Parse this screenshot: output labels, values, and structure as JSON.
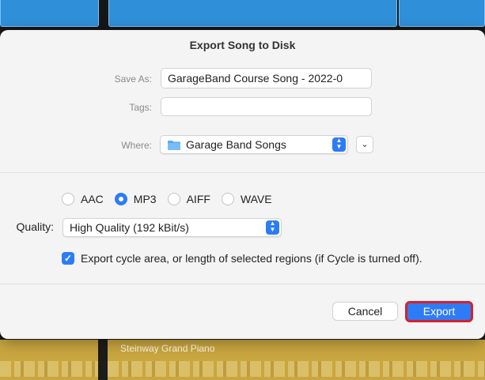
{
  "background": {
    "region_label": "Steinway Grand Piano"
  },
  "dialog": {
    "title": "Export Song to Disk",
    "save_as_label": "Save As:",
    "save_as_value": "GarageBand Course Song - 2022-0",
    "tags_label": "Tags:",
    "tags_value": "",
    "where_label": "Where:",
    "where_value": "Garage Band Songs",
    "formats": [
      {
        "label": "AAC",
        "selected": false
      },
      {
        "label": "MP3",
        "selected": true
      },
      {
        "label": "AIFF",
        "selected": false
      },
      {
        "label": "WAVE",
        "selected": false
      }
    ],
    "quality_label": "Quality:",
    "quality_value": "High Quality (192 kBit/s)",
    "export_cycle_label": "Export cycle area, or length of selected regions (if Cycle is turned off).",
    "export_cycle_checked": true,
    "cancel_label": "Cancel",
    "export_label": "Export"
  },
  "colors": {
    "accent": "#2d7cf6",
    "highlight_border": "#d8202a",
    "blue_region": "#2f8fd8",
    "yellow_region": "#c9a640"
  }
}
